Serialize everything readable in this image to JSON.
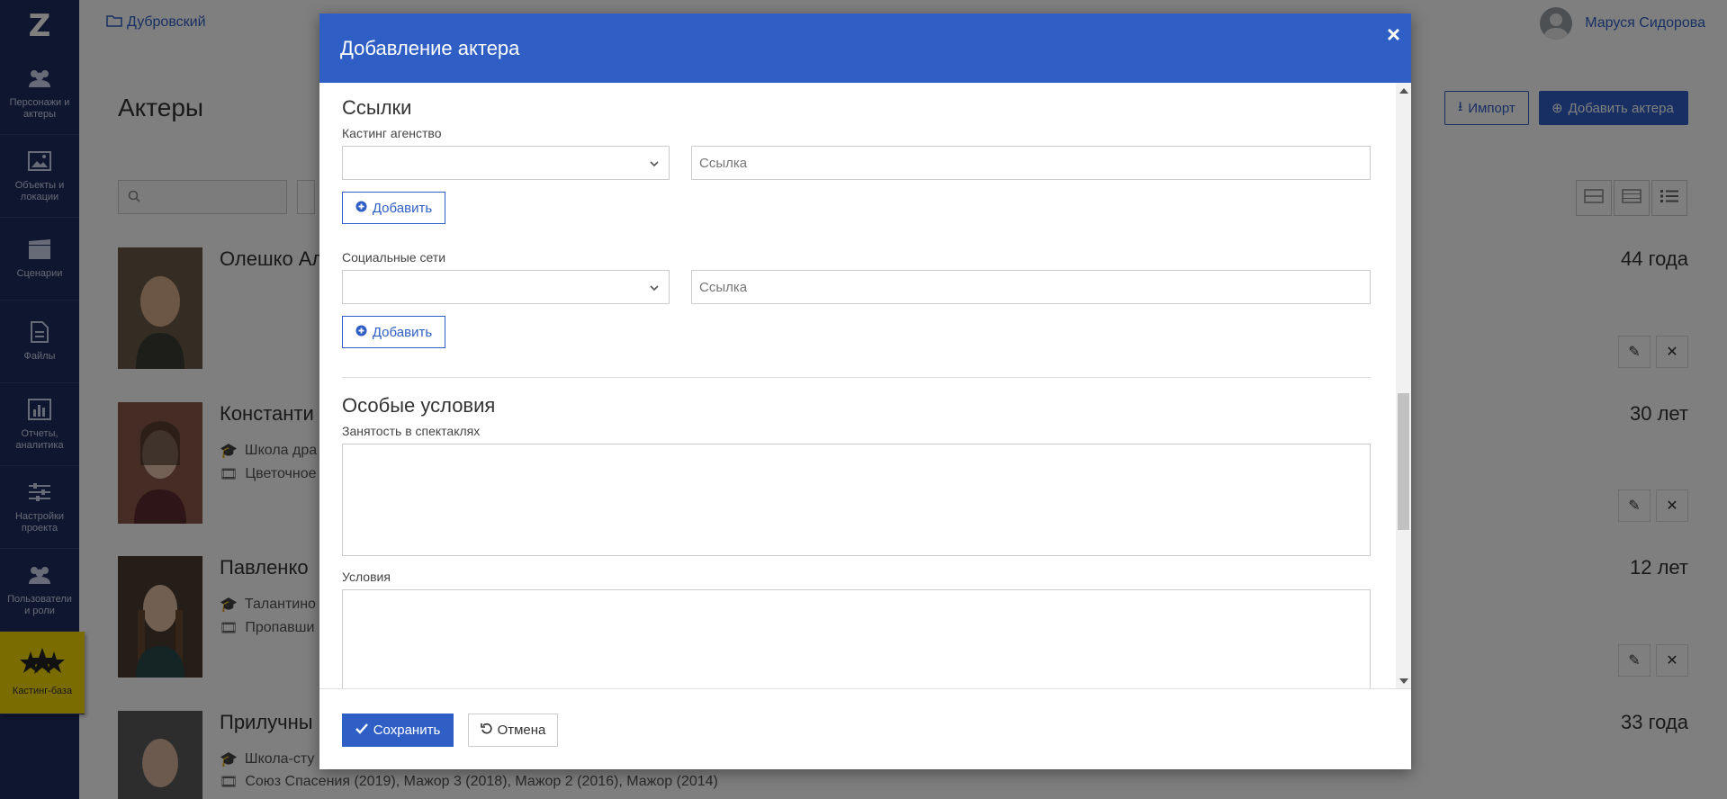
{
  "app": {
    "logo": "Z",
    "project_name": "Дубровский",
    "user_name": "Маруся Сидорова"
  },
  "sidebar": {
    "items": [
      {
        "label": "Персонажи и актеры",
        "icon": "people-icon"
      },
      {
        "label": "Объекты и локации",
        "icon": "image-icon"
      },
      {
        "label": "Сценарии",
        "icon": "clapperboard-icon"
      },
      {
        "label": "Файлы",
        "icon": "file-icon"
      },
      {
        "label": "Отчеты, аналитика",
        "icon": "bar-chart-icon"
      },
      {
        "label": "Настройки проекта",
        "icon": "sliders-icon"
      },
      {
        "label": "Пользователи и роли",
        "icon": "users-icon"
      },
      {
        "label": "Кастинг-база",
        "icon": "stars-icon"
      }
    ]
  },
  "page": {
    "title": "Актеры",
    "import_label": "Импорт",
    "add_actor_label": "Добавить актера"
  },
  "actors": [
    {
      "name": "Олешко Ал",
      "age": "44 года",
      "line1": "",
      "line2": ""
    },
    {
      "name": "Константи",
      "age": "30 лет",
      "line1": "Школа дра",
      "line2": "Цветочное"
    },
    {
      "name": "Павленко",
      "age": "12 лет",
      "line1": "Талантино",
      "line2": "Пропавши"
    },
    {
      "name": "Прилучны",
      "age": "33 года",
      "line1": "Школа-сту",
      "line2": "Союз Спасения (2019), Мажор 3 (2018), Мажор 2 (2016), Мажор (2014)"
    }
  ],
  "modal": {
    "title": "Добавление актера",
    "close_symbol": "×",
    "links_section_title": "Ссылки",
    "casting_agency_label": "Кастинг агенство",
    "casting_agency_link_placeholder": "Ссылка",
    "social_label": "Социальные сети",
    "social_link_placeholder": "Ссылка",
    "add_label": "Добавить",
    "special_section_title": "Особые условия",
    "theatre_label": "Занятость в спектаклях",
    "conditions_label": "Условия",
    "save_label": "Сохранить",
    "cancel_label": "Отмена"
  },
  "colors": {
    "primary": "#2f5fc4",
    "sidebar": "#1f2c5e",
    "active_nav": "#f6d800"
  }
}
